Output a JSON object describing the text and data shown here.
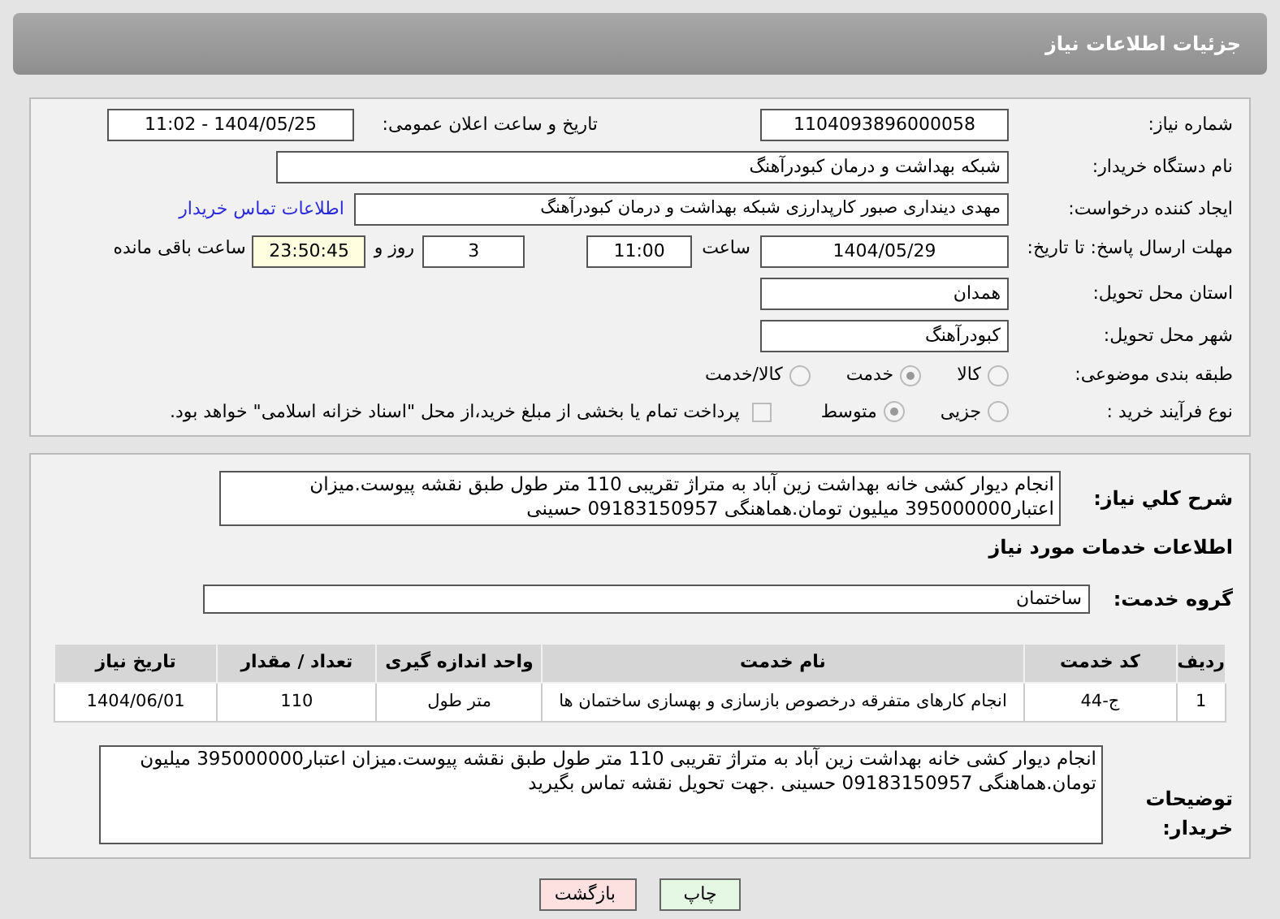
{
  "header": {
    "title": "جزئیات اطلاعات نیاز"
  },
  "need_number": {
    "label": "شماره نیاز:",
    "value": "1104093896000058"
  },
  "announce_date": {
    "label": "تاریخ و ساعت اعلان عمومی:",
    "value": "1404/05/25 - 11:02"
  },
  "buyer": {
    "label": "نام دستگاه خریدار:",
    "value": "شبکه بهداشت و درمان کبودرآهنگ"
  },
  "creator": {
    "label": "ایجاد کننده درخواست:",
    "value": "مهدی دینداری صبور کارپدارزی شبکه بهداشت و درمان کبودرآهنگ",
    "link": "اطلاعات تماس خریدار"
  },
  "deadline": {
    "label": "مهلت ارسال پاسخ: تا تاریخ:",
    "date": "1404/05/29",
    "time_label": "ساعت",
    "time": "11:00",
    "days": "3",
    "days_label": "روز و",
    "remaining": "23:50:45",
    "remaining_label": "ساعت باقی مانده"
  },
  "province": {
    "label": "استان محل تحویل:",
    "value": "همدان"
  },
  "city": {
    "label": "شهر محل تحویل:",
    "value": "کبودرآهنگ"
  },
  "category": {
    "label": "طبقه بندی موضوعی:",
    "options": [
      {
        "label": "کالا",
        "selected": false
      },
      {
        "label": "خدمت",
        "selected": true
      },
      {
        "label": "کالا/خدمت",
        "selected": false
      }
    ]
  },
  "process": {
    "label": "نوع فرآیند خرید :",
    "options": [
      {
        "label": "جزیی",
        "selected": false
      },
      {
        "label": "متوسط",
        "selected": true
      }
    ],
    "payment": {
      "label": "پرداخت تمام یا بخشی از مبلغ خرید،از محل \"اسناد خزانه اسلامی\" خواهد بود.",
      "checked": false
    }
  },
  "description": {
    "label": "شرح کلي نياز:",
    "value": "انجام دیوار کشی خانه بهداشت زین آباد به متراژ تقریبی 110 متر طول طبق نقشه پیوست.میزان اعتبار395000000 میلیون تومان.هماهنگی 09183150957 حسینی"
  },
  "services_title": "اطلاعات خدمات مورد نیاز",
  "service_group": {
    "label": "گروه خدمت:",
    "value": "ساختمان"
  },
  "table": {
    "columns": [
      "ردیف",
      "کد خدمت",
      "نام خدمت",
      "واحد اندازه گیری",
      "تعداد / مقدار",
      "تاریخ نیاز"
    ],
    "rows": [
      [
        "1",
        "ج-44",
        "انجام کارهای متفرقه درخصوص بازسازی و بهسازی ساختمان ها",
        "متر طول",
        "110",
        "1404/06/01"
      ]
    ]
  },
  "buyer_notes": {
    "label": "توضیحات خریدار:",
    "value": "انجام دیوار کشی خانه بهداشت زین آباد به متراژ تقریبی 110 متر طول طبق نقشه پیوست.میزان اعتبار395000000 میلیون تومان.هماهنگی 09183150957 حسینی .جهت تحویل نقشه تماس بگیرید"
  },
  "buttons": [
    {
      "label": "چاپ",
      "kind": "print"
    },
    {
      "label": "بازگشت",
      "kind": "back"
    }
  ]
}
